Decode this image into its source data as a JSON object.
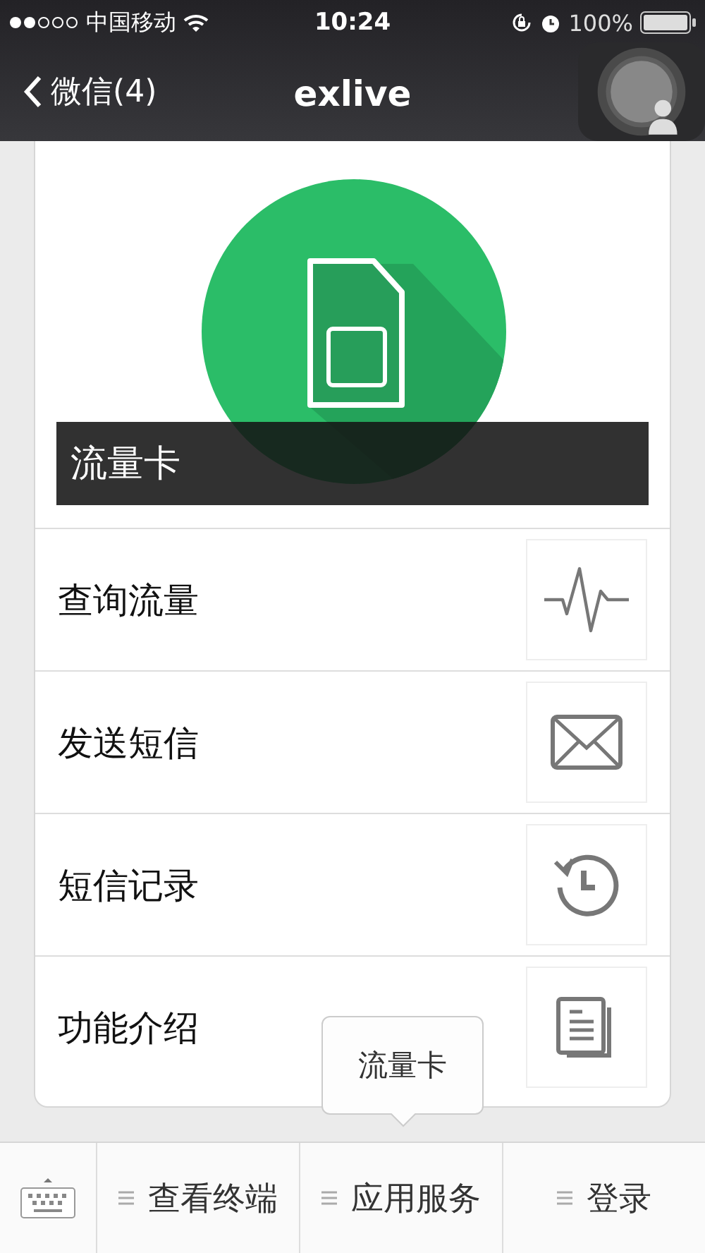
{
  "status_bar": {
    "carrier": "中国移动",
    "time": "10:24",
    "battery": "100%"
  },
  "nav_bar": {
    "back_label": "微信(4)",
    "title": "exlive"
  },
  "banner": {
    "label": "流量卡"
  },
  "menu_rows": [
    {
      "label": "查询流量",
      "kind": "pulse"
    },
    {
      "label": "发送短信",
      "kind": "mail"
    },
    {
      "label": "短信记录",
      "kind": "history"
    },
    {
      "label": "功能介绍",
      "kind": "document"
    }
  ],
  "bottom_menu": [
    {
      "kind": "keyboard"
    },
    {
      "kind": "menu",
      "label": "查看终端"
    },
    {
      "kind": "menu",
      "label": "应用服务",
      "submenu": [
        {
          "label": "流量卡"
        }
      ]
    },
    {
      "kind": "menu",
      "label": "登录"
    }
  ]
}
